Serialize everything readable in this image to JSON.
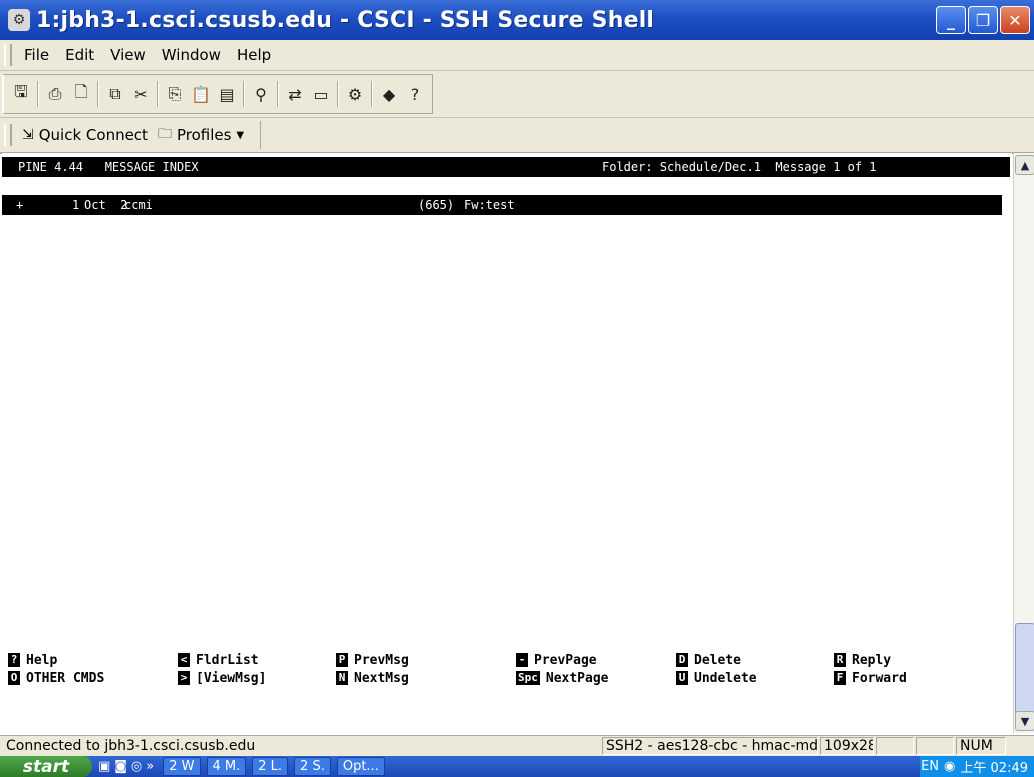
{
  "window": {
    "title": "1:jbh3-1.csci.csusb.edu - CSCI - SSH Secure Shell",
    "controls": [
      "minimize",
      "maximize",
      "close"
    ]
  },
  "menu": [
    "File",
    "Edit",
    "View",
    "Window",
    "Help"
  ],
  "toolbar_icons": [
    "save-icon",
    "print-icon",
    "print-preview-icon",
    "new-connection-icon",
    "disconnect-icon",
    "copy-icon",
    "paste-icon",
    "paste-special-icon",
    "find-icon",
    "file-transfer-icon",
    "new-terminal-icon",
    "settings-icon",
    "profile-icon",
    "help-icon"
  ],
  "quickbar": {
    "quick_connect": "Quick Connect",
    "profiles": "Profiles"
  },
  "pine": {
    "header_left": "PINE 4.44   MESSAGE INDEX",
    "header_right": "Folder: Schedule/Dec.1  Message 1 of 1",
    "rows": [
      {
        "status": "+",
        "num": "1",
        "date": "Oct  2",
        "from": "ccmi",
        "size": "(665)",
        "subject": "Fw:test"
      }
    ],
    "keys": [
      [
        {
          "key": "?",
          "label": "Help"
        },
        {
          "key": "O",
          "label": "OTHER CMDS"
        }
      ],
      [
        {
          "key": "<",
          "label": "FldrList"
        },
        {
          "key": ">",
          "label": "[ViewMsg]"
        }
      ],
      [
        {
          "key": "P",
          "label": "PrevMsg"
        },
        {
          "key": "N",
          "label": "NextMsg"
        }
      ],
      [
        {
          "key": "-",
          "label": "PrevPage"
        },
        {
          "key": "Spc",
          "label": "NextPage"
        }
      ],
      [
        {
          "key": "D",
          "label": "Delete"
        },
        {
          "key": "U",
          "label": "Undelete"
        }
      ],
      [
        {
          "key": "R",
          "label": "Reply"
        },
        {
          "key": "F",
          "label": "Forward"
        }
      ]
    ]
  },
  "status": {
    "connection": "Connected to jbh3-1.csci.csusb.edu",
    "cipher": "SSH2 - aes128-cbc - hmac-md5",
    "size": "109x28",
    "numlock": "NUM"
  },
  "taskbar": {
    "start": "start",
    "tasks": [
      "2 W",
      "4 M.",
      "2 L.",
      "2 S.",
      "Opt..."
    ],
    "tray_lang": "EN",
    "clock": "上午 02:49"
  }
}
